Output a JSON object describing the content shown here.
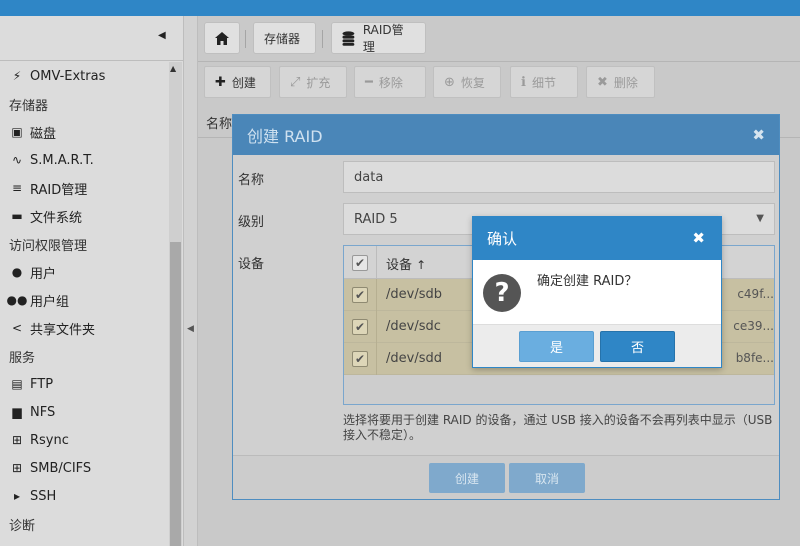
{
  "sidebar": {
    "collapse_icon": "chevron-left-icon",
    "items": [
      {
        "label": "OMV-Extras",
        "icon": "plug-icon",
        "glyph": "⚡",
        "head": false
      },
      {
        "label": "存储器",
        "icon": "",
        "glyph": "",
        "head": true
      },
      {
        "label": "磁盘",
        "icon": "disk-icon",
        "glyph": "▣",
        "head": false
      },
      {
        "label": "S.M.A.R.T.",
        "icon": "heartbeat-icon",
        "glyph": "∿",
        "head": false
      },
      {
        "label": "RAID管理",
        "icon": "database-icon",
        "glyph": "≡",
        "head": false
      },
      {
        "label": "文件系统",
        "icon": "folder-icon",
        "glyph": "▬",
        "head": false
      },
      {
        "label": "访问权限管理",
        "icon": "",
        "glyph": "",
        "head": true
      },
      {
        "label": "用户",
        "icon": "user-icon",
        "glyph": "●",
        "head": false
      },
      {
        "label": "用户组",
        "icon": "users-icon",
        "glyph": "●●",
        "head": false
      },
      {
        "label": "共享文件夹",
        "icon": "share-icon",
        "glyph": "<",
        "head": false
      },
      {
        "label": "服务",
        "icon": "",
        "glyph": "",
        "head": true
      },
      {
        "label": "FTP",
        "icon": "server-icon",
        "glyph": "▤",
        "head": false
      },
      {
        "label": "NFS",
        "icon": "desktop-icon",
        "glyph": "▆",
        "head": false
      },
      {
        "label": "Rsync",
        "icon": "sitemap-icon",
        "glyph": "⊞",
        "head": false
      },
      {
        "label": "SMB/CIFS",
        "icon": "windows-icon",
        "glyph": "⊞",
        "head": false
      },
      {
        "label": "SSH",
        "icon": "terminal-icon",
        "glyph": "▸",
        "head": false
      },
      {
        "label": "诊断",
        "icon": "",
        "glyph": "",
        "head": true
      }
    ]
  },
  "breadcrumb": {
    "home_icon": "home-icon",
    "items": [
      "存储器",
      "RAID管理"
    ]
  },
  "toolbar": {
    "create": "创建",
    "grow": "扩充",
    "remove": "移除",
    "recover": "恢复",
    "detail": "细节",
    "delete": "删除"
  },
  "grid": {
    "name_header": "名称"
  },
  "create_raid": {
    "title": "创建 RAID",
    "name_label": "名称",
    "name_value": "data",
    "level_label": "级别",
    "level_value": "RAID 5",
    "devices_label": "设备",
    "devices_header": "设备",
    "devices": [
      {
        "path": "/dev/sdb",
        "serial": "c49f...",
        "checked": true
      },
      {
        "path": "/dev/sdc",
        "serial": "ce39...",
        "checked": true
      },
      {
        "path": "/dev/sdd",
        "serial": "b8fe...",
        "checked": true
      }
    ],
    "hint": "选择将要用于创建 RAID 的设备，通过 USB 接入的设备不会再列表中显示（USB 接入不稳定）。",
    "create_button": "创建",
    "cancel_button": "取消"
  },
  "confirm": {
    "title": "确认",
    "message": "确定创建 RAID？",
    "yes": "是",
    "no": "否"
  }
}
